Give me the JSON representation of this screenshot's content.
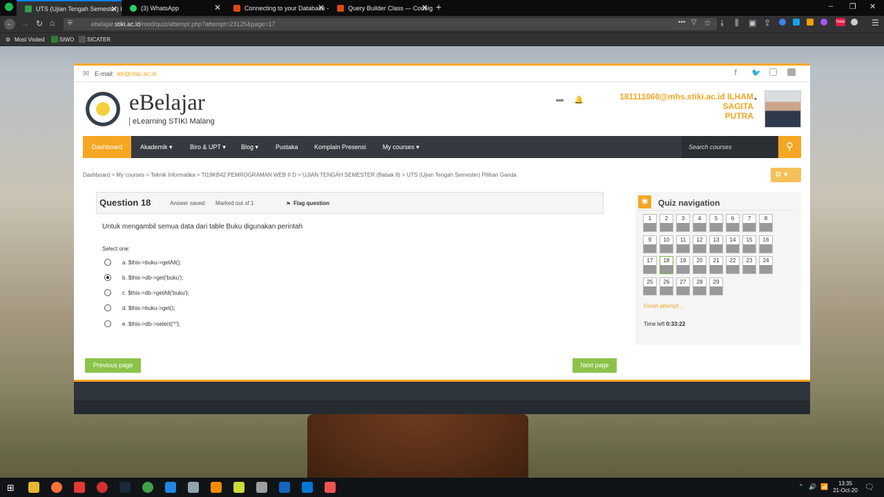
{
  "browser": {
    "tabs": [
      {
        "label": "UTS (Ujian Tengah Semester) Pi",
        "active": true,
        "color": "#2ea043"
      },
      {
        "label": "(3) WhatsApp",
        "active": false,
        "color": "#25d366"
      },
      {
        "label": "Connecting to your Database -",
        "active": false,
        "color": "#dd4814"
      },
      {
        "label": "Query Builder Class — Codeign",
        "active": false,
        "color": "#dd4814"
      }
    ],
    "url_prefix": "ebelajar.",
    "url_domain": "stiki.ac.id",
    "url_path": "/mod/quiz/attempt.php?attempt=23125&page=17",
    "bookmarks": [
      "Most Visited",
      "SIWO",
      "SICATER"
    ]
  },
  "site": {
    "email_label": "E-mail:",
    "email": "ikti@stiki.ac.id",
    "brand": "eBelajar",
    "brand_sub": "eLearning STIKI Malang",
    "user_line1": "181111060@mhs.stiki.ac.id ILHAM SAGITA",
    "user_line2": "PUTRA"
  },
  "menu": {
    "dashboard": "Dashboard",
    "akademik": "Akademik ▾",
    "biro": "Biro & UPT ▾",
    "blog": "Blog ▾",
    "pustaka": "Pustaka",
    "komplain": "Komplain Presensi",
    "mycourses": "My courses ▾",
    "search_placeholder": "Search courses"
  },
  "breadcrumb": "Dashboard  >  My courses  >  Teknik Informatika  >  TI19KB42 PEMROGRAMAN WEB II D  >  UJIAN TENGAH SEMESTER (Babak 8)  >  UTS (Ujian Tengah Semester) Pilihan Ganda",
  "question": {
    "title": "Question 18",
    "status": "Answer saved",
    "marks": "Marked out of 1",
    "flag": "Flag question",
    "text": "Untuk mengambil semua data dari table Buku digunakan perintah",
    "select_label": "Select one:",
    "options": [
      {
        "label": "a. $this->buku->getAll();",
        "selected": false
      },
      {
        "label": "b. $this->db->get('buku');",
        "selected": true
      },
      {
        "label": "c. $this->db->getAll('buku');",
        "selected": false
      },
      {
        "label": "d. $this->buku->get();",
        "selected": false
      },
      {
        "label": "e. $this->db->select('*');",
        "selected": false
      }
    ]
  },
  "buttons": {
    "previous": "Previous page",
    "next": "Next page"
  },
  "quiz_nav": {
    "title": "Quiz navigation",
    "numbers": [
      "1",
      "2",
      "3",
      "4",
      "5",
      "6",
      "7",
      "8",
      "9",
      "10",
      "11",
      "12",
      "13",
      "14",
      "15",
      "16",
      "17",
      "18",
      "19",
      "20",
      "21",
      "22",
      "23",
      "24",
      "25",
      "26",
      "27",
      "28",
      "29"
    ],
    "current": "18",
    "finish": "Finish attempt ...",
    "time_label": "Time left",
    "time_value": "0:33:22"
  },
  "taskbar": {
    "time": "13:35",
    "date": "21-Oct-20"
  }
}
